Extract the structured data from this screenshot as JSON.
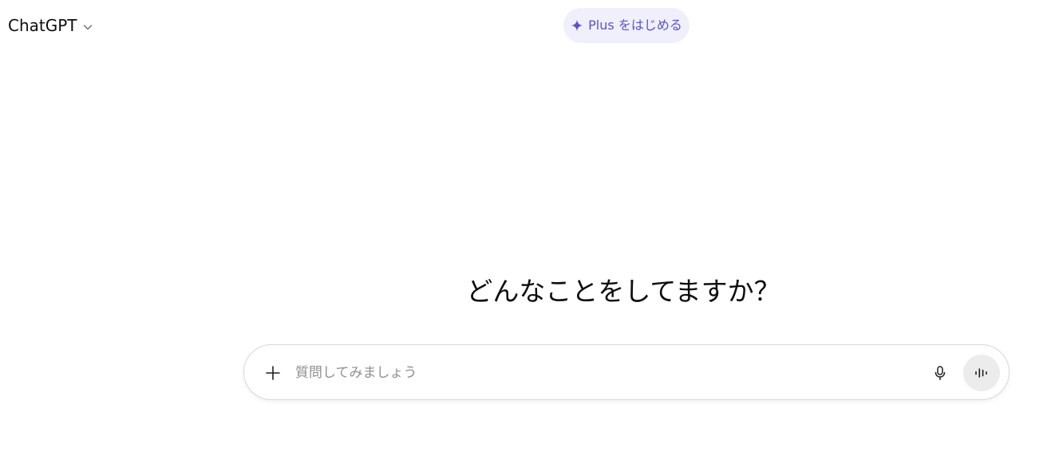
{
  "header": {
    "model_name": "ChatGPT",
    "model_selector_icon": "chevron-down-icon",
    "upgrade_label": "Plus をはじめる",
    "upgrade_icon": "sparkle-icon"
  },
  "main": {
    "heading": "どんなことをしてますか？"
  },
  "composer": {
    "placeholder": "質問してみましょう",
    "value": "",
    "attach_icon": "plus-icon",
    "dictate_icon": "mic-icon",
    "voice_icon": "voice-wave-icon"
  },
  "colors": {
    "upgrade_accent": "#5a55c4",
    "upgrade_background": "#f0effc",
    "voice_button_background": "#ececec",
    "text": "#0d0d0d",
    "placeholder": "#8f8f8f"
  }
}
